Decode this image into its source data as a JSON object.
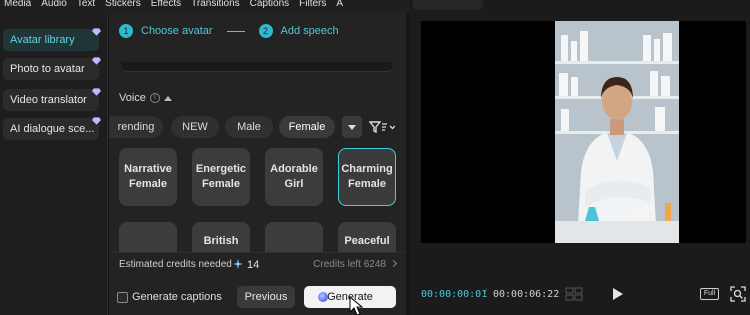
{
  "menu": {
    "items": [
      "Media",
      "Audio",
      "Text",
      "Stickers",
      "Effects",
      "Transitions",
      "Captions",
      "Filters",
      "A"
    ]
  },
  "sidebar": {
    "items": [
      {
        "label": "Avatar library",
        "active": true
      },
      {
        "label": "Photo to avatar",
        "active": false
      },
      {
        "label": "Video translator",
        "active": false
      },
      {
        "label": "AI dialogue sce...",
        "active": false
      }
    ]
  },
  "steps": [
    {
      "num": "1",
      "label": "Choose avatar"
    },
    {
      "num": "2",
      "label": "Add speech"
    }
  ],
  "voice": {
    "label": "Voice",
    "info": "i",
    "filters": [
      "rending",
      "NEW",
      "Male",
      "Female"
    ],
    "selected_filter": "Female",
    "cards_row1": [
      "Narrative Female",
      "Energetic Female",
      "Adorable Girl",
      "Charming Female"
    ],
    "cards_row2": [
      "",
      "British",
      "",
      "Peaceful"
    ],
    "selected_card": "Charming Female"
  },
  "credits": {
    "needed_label": "Estimated credits needed",
    "needed_value": "14",
    "left_label": "Credits left 6248"
  },
  "footer": {
    "captions_label": "Generate captions",
    "previous_label": "Previous",
    "generate_label": "Generate"
  },
  "player": {
    "current_time": "00:00:00:01",
    "separator": "/",
    "total_time": "00:00:06:22",
    "full_label": "Full"
  },
  "colors": {
    "accent": "#2fb9cc",
    "panel": "#232323",
    "sidebar_active": "#203538"
  }
}
